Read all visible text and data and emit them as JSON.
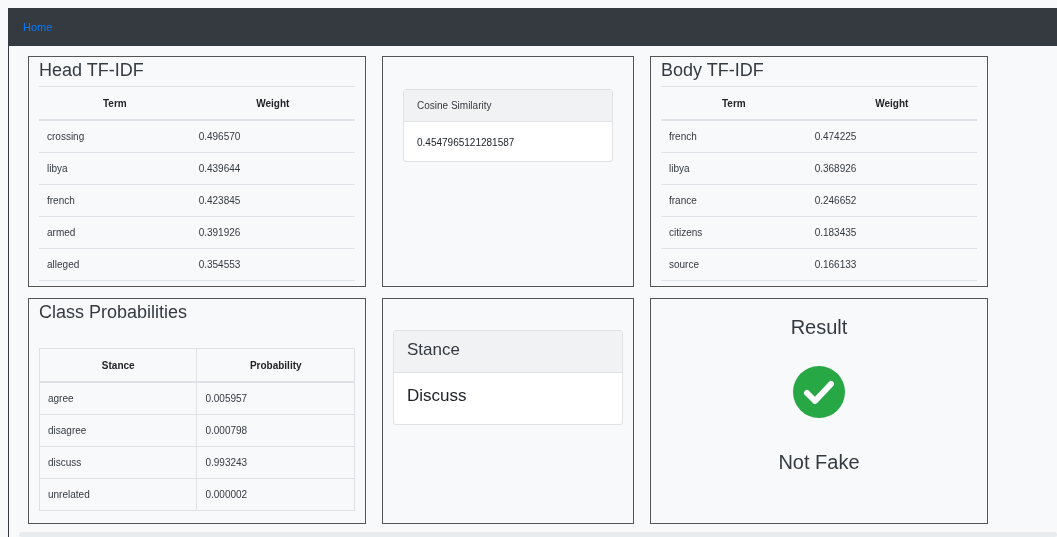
{
  "navbar": {
    "link": "Home"
  },
  "head_tfidf": {
    "title": "Head TF-IDF",
    "columns": [
      "Term",
      "Weight"
    ],
    "rows": [
      [
        "crossing",
        "0.496570"
      ],
      [
        "libya",
        "0.439644"
      ],
      [
        "french",
        "0.423845"
      ],
      [
        "armed",
        "0.391926"
      ],
      [
        "alleged",
        "0.354553"
      ]
    ]
  },
  "cosine": {
    "title": "Cosine Similarity",
    "value": "0.4547965121281587"
  },
  "body_tfidf": {
    "title": "Body TF-IDF",
    "columns": [
      "Term",
      "Weight"
    ],
    "rows": [
      [
        "french",
        "0.474225"
      ],
      [
        "libya",
        "0.368926"
      ],
      [
        "france",
        "0.246652"
      ],
      [
        "citizens",
        "0.183435"
      ],
      [
        "source",
        "0.166133"
      ]
    ]
  },
  "class_probabilities": {
    "title": "Class Probabilities",
    "columns": [
      "Stance",
      "Probability"
    ],
    "rows": [
      [
        "agree",
        "0.005957"
      ],
      [
        "disagree",
        "0.000798"
      ],
      [
        "discuss",
        "0.993243"
      ],
      [
        "unrelated",
        "0.000002"
      ]
    ]
  },
  "stance": {
    "title": "Stance",
    "value": "Discuss"
  },
  "result": {
    "title": "Result",
    "fake": false,
    "label": "Not Fake"
  }
}
